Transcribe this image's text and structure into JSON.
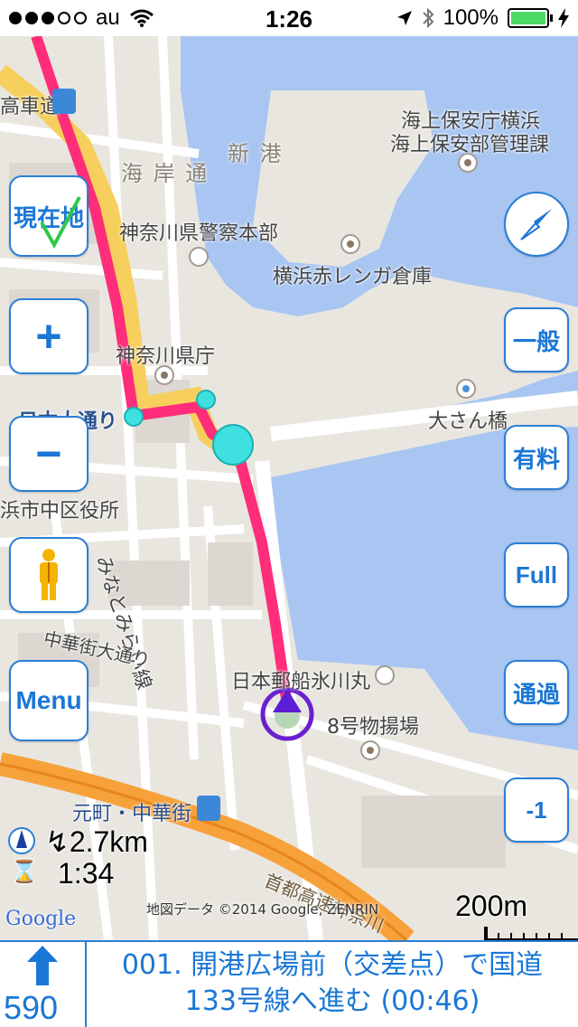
{
  "status_bar": {
    "carrier": "au",
    "time": "1:26",
    "battery": "100%"
  },
  "map": {
    "labels": {
      "train_station_top": "高車道",
      "coast_guard_1": "海上保安庁横浜",
      "coast_guard_2": "海上保安部管理課",
      "shinko": "新 港",
      "kaigandori": "海 岸 通",
      "police": "神奈川県警察本部",
      "renga": "横浜赤レンガ倉庫",
      "prefectural_office": "神奈川県庁",
      "nihon_odori": "日本大通り",
      "osanbashi": "大さん橋",
      "city_office": "浜市中区役所",
      "minatomirai": "みなとみらい線",
      "chinatown_st": "中華街大通り",
      "hikawamaru": "日本郵船氷川丸",
      "warehouse8": "8号物揚場",
      "motomachi": "元町・中華街",
      "expressway": "首都高速神奈川",
      "copyright": "地図データ ©2014 Google, ZENRIN",
      "google": "Google",
      "scale": "200m"
    }
  },
  "buttons": {
    "current_location": "現在地",
    "zoom_in": "+",
    "zoom_out": "−",
    "menu": "Menu",
    "general": "一般",
    "toll": "有料",
    "full": "Full",
    "pass": "通過",
    "minus_one": "-1"
  },
  "nav_info": {
    "distance": "2.7km",
    "time": "1:34"
  },
  "instruction": {
    "distance": "590",
    "line1": "001. 開港広場前（交差点）で国道",
    "line2": "133号線へ進む (00:46)"
  },
  "colors": {
    "accent": "#1a77d6",
    "route": "#ff2d7a",
    "water": "#a9c6f2",
    "land": "#e9e6e0"
  }
}
